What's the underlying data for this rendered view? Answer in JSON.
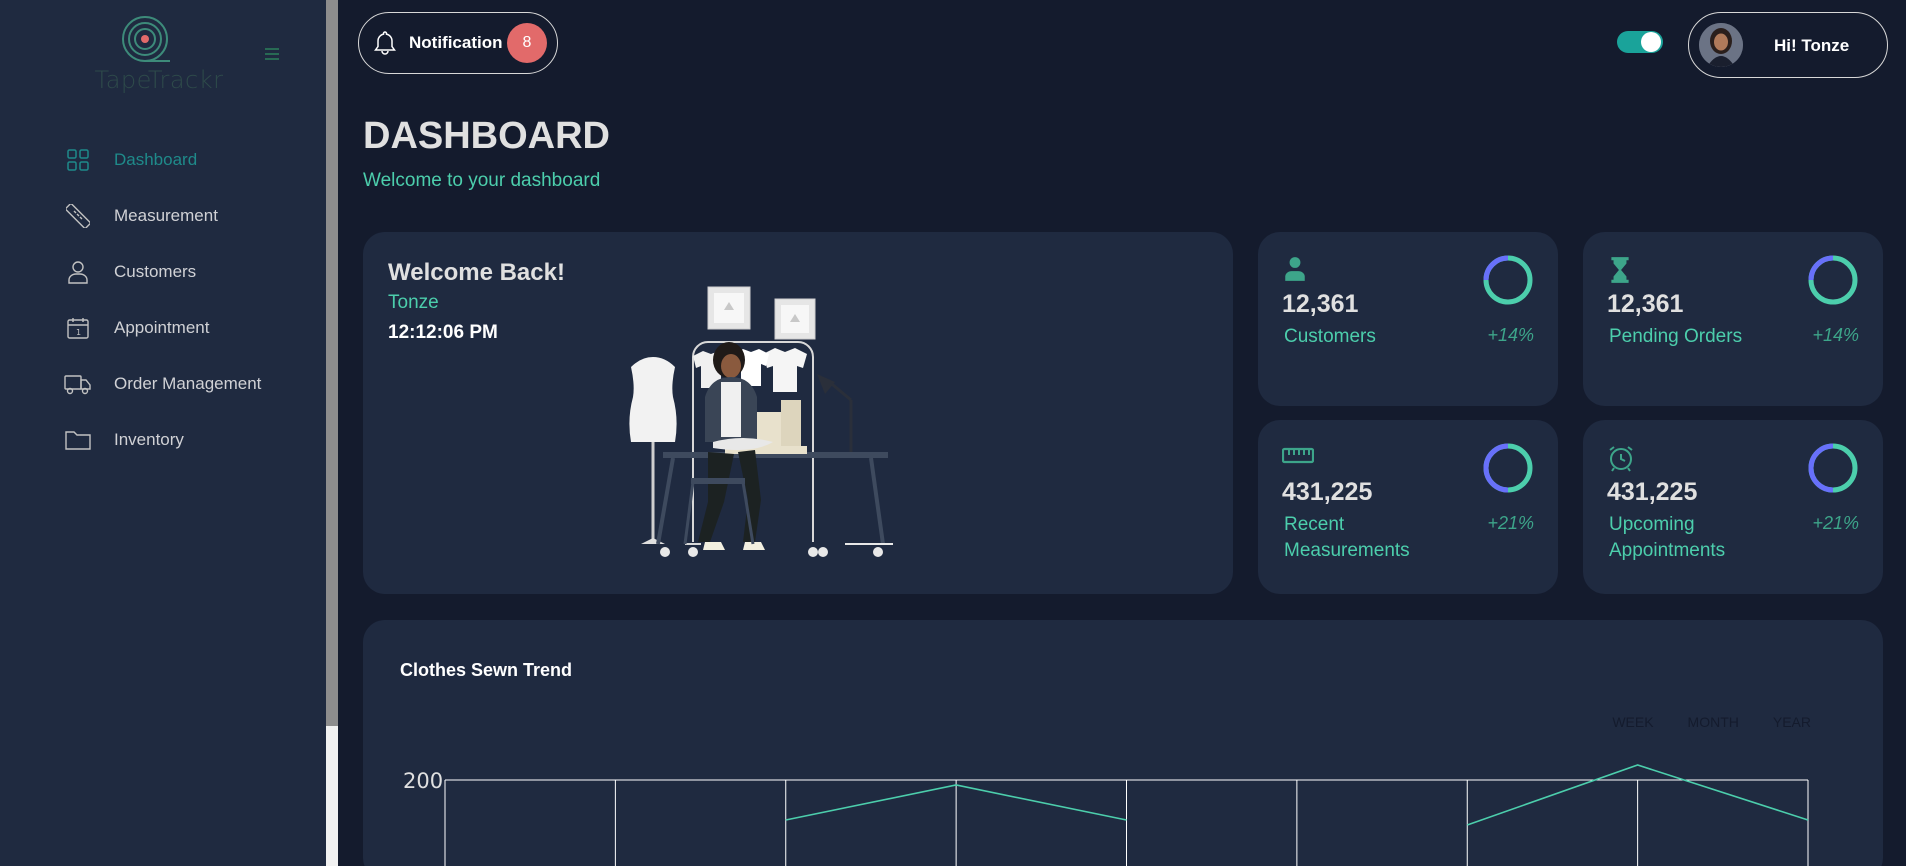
{
  "app": {
    "logo_text": "TapeTrackr"
  },
  "sidebar": {
    "items": [
      {
        "label": "Dashboard",
        "icon": "grid-icon",
        "active": true
      },
      {
        "label": "Measurement",
        "icon": "ruler-icon",
        "active": false
      },
      {
        "label": "Customers",
        "icon": "person-icon",
        "active": false
      },
      {
        "label": "Appointment",
        "icon": "calendar-icon",
        "active": false
      },
      {
        "label": "Order Management",
        "icon": "truck-icon",
        "active": false
      },
      {
        "label": "Inventory",
        "icon": "folder-icon",
        "active": false
      }
    ]
  },
  "topbar": {
    "notification_label": "Notification",
    "notification_count": "8",
    "theme_toggle_on": true,
    "greeting": "Hi! Tonze"
  },
  "header": {
    "title": "DASHBOARD",
    "subtitle": "Welcome to your dashboard"
  },
  "welcome": {
    "title": "Welcome Back!",
    "name": "Tonze",
    "time": "12:12:06 PM"
  },
  "stats": [
    {
      "value": "12,361",
      "label": "Customers",
      "change": "+14%",
      "icon": "person-icon",
      "progress": 0.75
    },
    {
      "value": "12,361",
      "label": "Pending Orders",
      "change": "+14%",
      "icon": "hourglass-icon",
      "progress": 0.75
    },
    {
      "value": "431,225",
      "label": "Recent Measurements",
      "change": "+21%",
      "icon": "ruler-icon",
      "progress": 0.5
    },
    {
      "value": "431,225",
      "label": "Upcoming Appointments",
      "change": "+21%",
      "icon": "alarm-icon",
      "progress": 0.5
    }
  ],
  "chart": {
    "title": "Clothes Sewn Trend",
    "ranges": [
      "WEEK",
      "MONTH",
      "YEAR"
    ]
  },
  "chart_data": {
    "type": "line",
    "title": "Clothes Sewn Trend",
    "yticks": [
      "200"
    ],
    "series": [
      {
        "values": [
          null,
          null,
          160,
          195,
          160,
          null,
          155,
          215,
          160
        ]
      }
    ]
  },
  "colors": {
    "accent": "#4cceac",
    "badge": "#e26a6a",
    "ring_blue": "#6870fa",
    "ring_green": "#4cceac"
  }
}
